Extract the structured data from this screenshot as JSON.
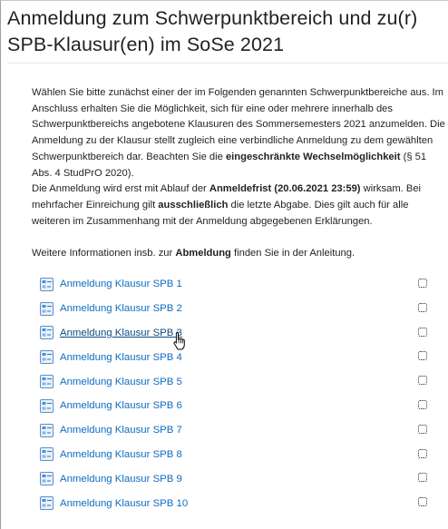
{
  "section": {
    "title": "Anmeldung zum Schwerpunktbereich und zu(r) SPB-Klausur(en) im SoSe 2021"
  },
  "intro": {
    "p1_a": "Wählen Sie bitte zunächst einer der im Folgenden genannten Schwerpunktbereiche aus. Im Anschluss erhalten Sie die Möglichkeit, sich für eine oder mehrere innerhalb des Schwerpunktbereichs angebotene Klausuren des Sommersemesters 2021 anzumelden. Die Anmeldung zu der Klausur stellt zugleich eine verbindliche Anmeldung zu dem gewählten Schwerpunktbereich dar. Beachten Sie die ",
    "p1_b": "eingeschränkte Wechselmöglichkeit",
    "p1_c": " (§ 51 Abs. 4 StudPrO 2020).",
    "p2_a": "Die Anmeldung wird erst mit Ablauf der ",
    "p2_b": "Anmeldefrist (20.06.2021 23:59)",
    "p2_c": " wirksam. Bei mehrfacher Einreichung gilt ",
    "p2_d": "ausschließlich",
    "p2_e": " die letzte Abgabe. Dies gilt auch für alle weiteren im Zusammenhang mit der Anmeldung abgegebenen Erklärungen.",
    "p3_a": "Weitere Informationen insb. zur ",
    "p3_b": "Abmeldung",
    "p3_c": " finden Sie in der Anleitung."
  },
  "activities": [
    {
      "label": "Anmeldung Klausur SPB 1",
      "icon": "choice-activity-icon",
      "completed": false,
      "hovered": false
    },
    {
      "label": "Anmeldung Klausur SPB 2",
      "icon": "choice-activity-icon",
      "completed": false,
      "hovered": false
    },
    {
      "label": "Anmeldung Klausur SPB 3",
      "icon": "choice-activity-icon",
      "completed": false,
      "hovered": true
    },
    {
      "label": "Anmeldung Klausur SPB 4",
      "icon": "choice-activity-icon",
      "completed": false,
      "hovered": false
    },
    {
      "label": "Anmeldung Klausur SPB 5",
      "icon": "choice-activity-icon",
      "completed": false,
      "hovered": false
    },
    {
      "label": "Anmeldung Klausur SPB 6",
      "icon": "choice-activity-icon",
      "completed": false,
      "hovered": false
    },
    {
      "label": "Anmeldung Klausur SPB 7",
      "icon": "choice-activity-icon",
      "completed": false,
      "hovered": false
    },
    {
      "label": "Anmeldung Klausur SPB 8",
      "icon": "choice-activity-icon",
      "completed": false,
      "hovered": false
    },
    {
      "label": "Anmeldung Klausur SPB 9",
      "icon": "choice-activity-icon",
      "completed": false,
      "hovered": false
    },
    {
      "label": "Anmeldung Klausur SPB 10",
      "icon": "choice-activity-icon",
      "completed": false,
      "hovered": false
    }
  ],
  "colors": {
    "link": "#0f6cbf",
    "text": "#1d2125",
    "icon_accent": "#4a90d9"
  }
}
